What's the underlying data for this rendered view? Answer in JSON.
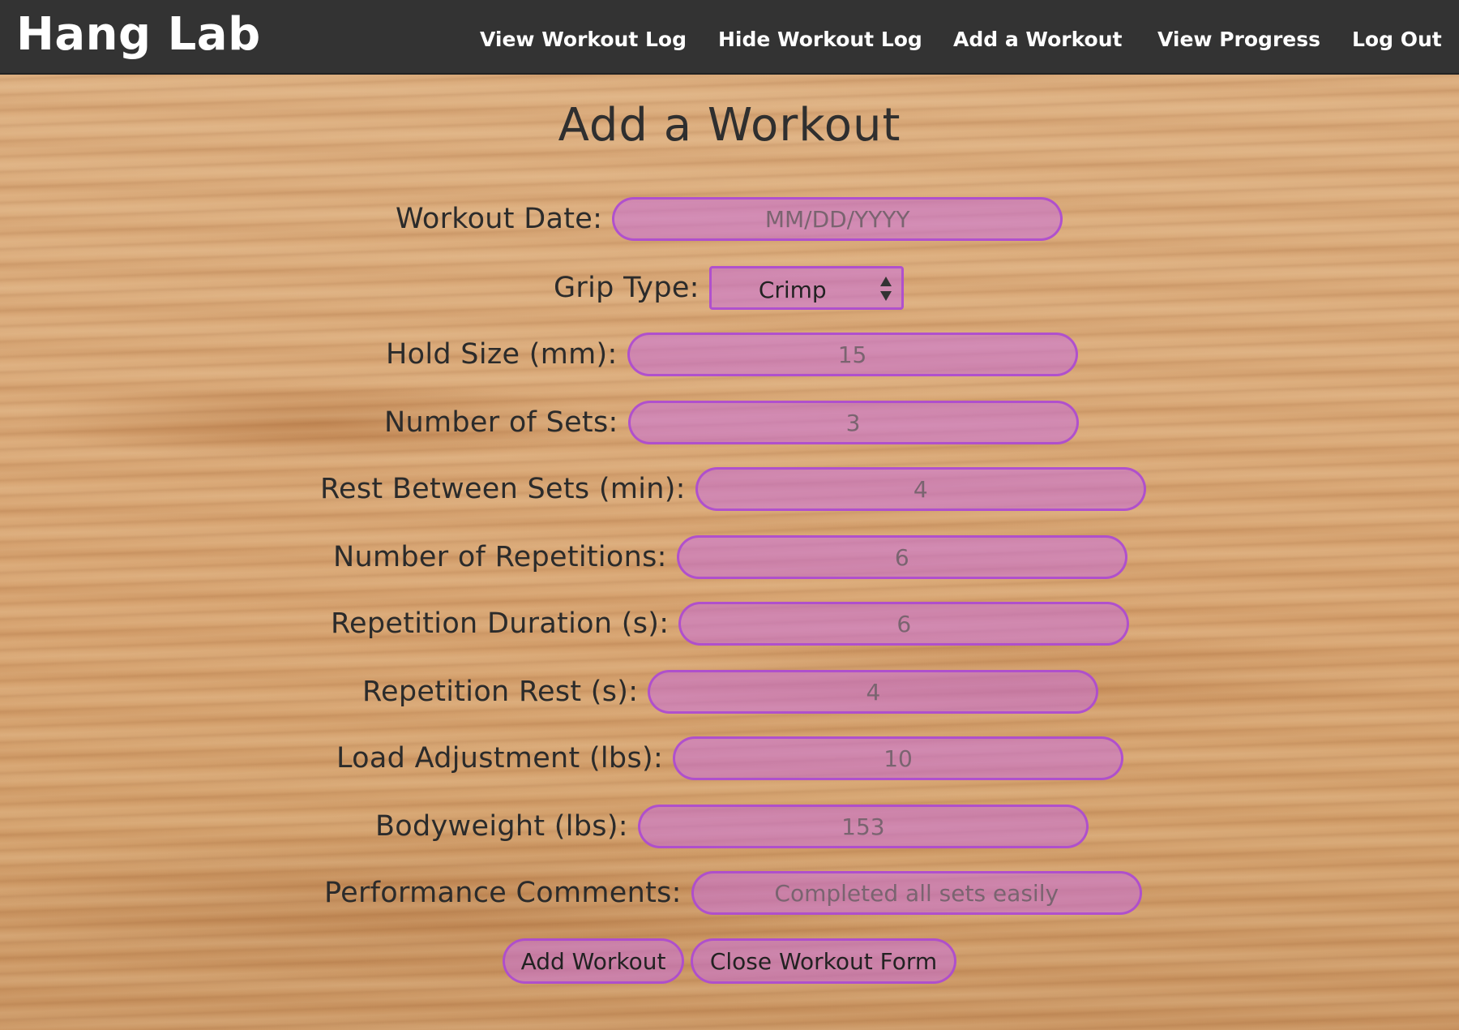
{
  "app": {
    "brand": "Hang Lab"
  },
  "nav": {
    "view_log": "View Workout Log",
    "hide_log": "Hide Workout Log",
    "add_workout": "Add a Workout",
    "view_progress": "View Progress",
    "log_out": "Log Out"
  },
  "form": {
    "title": "Add a Workout",
    "workout_date": {
      "label": "Workout Date:",
      "value": "",
      "placeholder": "MM/DD/YYYY"
    },
    "grip_type": {
      "label": "Grip Type:",
      "value": "Crimp"
    },
    "hold_size": {
      "label": "Hold Size (mm):",
      "value": "",
      "placeholder": "15"
    },
    "num_sets": {
      "label": "Number of Sets:",
      "value": "",
      "placeholder": "3"
    },
    "rest_between_sets": {
      "label": "Rest Between Sets (min):",
      "value": "",
      "placeholder": "4"
    },
    "num_reps": {
      "label": "Number of Repetitions:",
      "value": "",
      "placeholder": "6"
    },
    "rep_duration": {
      "label": "Repetition Duration (s):",
      "value": "",
      "placeholder": "6"
    },
    "rep_rest": {
      "label": "Repetition Rest (s):",
      "value": "",
      "placeholder": "4"
    },
    "load_adjustment": {
      "label": "Load Adjustment (lbs):",
      "value": "",
      "placeholder": "10"
    },
    "bodyweight": {
      "label": "Bodyweight (lbs):",
      "value": "",
      "placeholder": "153"
    },
    "comments": {
      "label": "Performance Comments:",
      "value": "",
      "placeholder": "Completed all sets easily"
    },
    "submit_label": "Add Workout",
    "close_label": "Close Workout Form"
  },
  "colors": {
    "navbar": "#333333",
    "input_fill": "#c86edc",
    "input_border": "#aa46d2"
  }
}
